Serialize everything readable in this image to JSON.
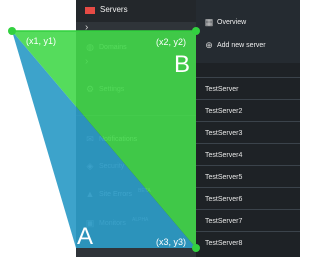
{
  "sidebar": {
    "header_title": "Servers",
    "items": [
      {
        "label": "Domains",
        "icon": "globe-icon"
      },
      {
        "label": "Settings",
        "icon": "gear-icon"
      },
      {
        "label": "Notifications",
        "icon": "envelope-icon"
      },
      {
        "label": "Security",
        "icon": "shield-icon"
      },
      {
        "label": "Site Errors",
        "icon": "warning-icon",
        "badge": "BETA"
      },
      {
        "label": "Monitors",
        "icon": "monitor-icon",
        "badge": "ALPHA"
      }
    ]
  },
  "right_panel": {
    "overview_label": "Overview",
    "add_server_label": "Add new server",
    "servers": [
      "TestServer",
      "TestServer2",
      "TestServer3",
      "TestServer4",
      "TestServer5",
      "TestServer6",
      "TestServer7",
      "TestServer8"
    ]
  },
  "annotation": {
    "point1_label": "(x1, y1)",
    "point2_label": "(x2, y2)",
    "point3_label": "(x3, y3)",
    "zone_a_label": "A",
    "zone_b_label": "B",
    "colors": {
      "zone_a": "#2c9bc7",
      "zone_b": "#43d84a",
      "point": "#32d13f",
      "text": "#ffffff"
    }
  }
}
